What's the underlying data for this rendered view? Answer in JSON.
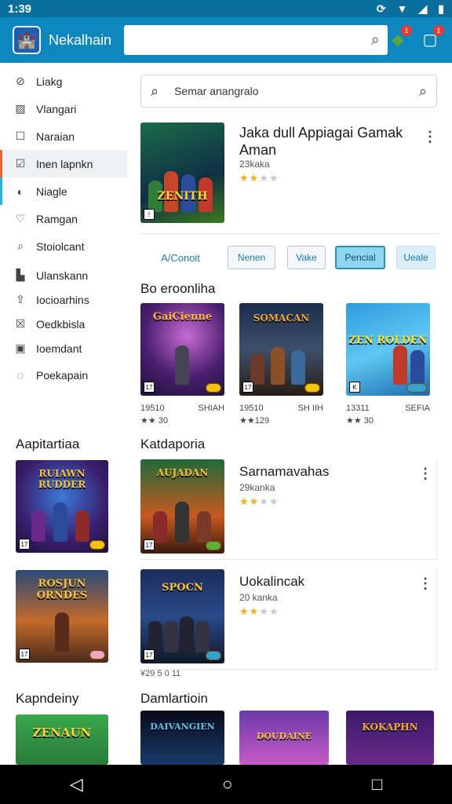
{
  "status": {
    "time": "1:39"
  },
  "appbar": {
    "app_name": "Nekalhain",
    "notif_count": "1",
    "msg_count": "1"
  },
  "sidebar": {
    "items": [
      {
        "label": "Liakg",
        "icon": "tag-icon"
      },
      {
        "label": "Vlangari",
        "icon": "image-icon"
      },
      {
        "label": "Naraian",
        "icon": "square-icon"
      },
      {
        "label": "Inen lapnkn",
        "icon": "checkbox-icon"
      },
      {
        "label": "Niagle",
        "icon": "droplet-icon"
      },
      {
        "label": "Ramgan",
        "icon": "heart-icon"
      },
      {
        "label": "Stoiolcant",
        "icon": "search-icon"
      },
      {
        "label": "Ulanskann",
        "icon": "bars-icon"
      },
      {
        "label": "Iocioarhins",
        "icon": "upload-icon"
      },
      {
        "label": "Oedkbisla",
        "icon": "close-box-icon"
      },
      {
        "label": "Ioemdant",
        "icon": "lock-icon"
      },
      {
        "label": "Poekapain",
        "icon": "chat-icon"
      }
    ]
  },
  "search": {
    "placeholder": "Semar anangralo"
  },
  "featured": {
    "title": "Jaka dull Appiagai Gamak Aman",
    "subtitle": "23kaka",
    "stars": 2,
    "cover": {
      "text": "ZENITH"
    }
  },
  "chips": [
    "A/Conoit",
    "Nenen",
    "Vake",
    "Pencial",
    "Ueale"
  ],
  "sections": {
    "recommend": "Bo eroonliha",
    "left_featured": "Aapitartiaa",
    "category": "Katdaporia",
    "left_bottom": "Kapndeiny",
    "bottom_main": "Damlartioin"
  },
  "grid": [
    {
      "cover": "GaiCienne",
      "num": "19510",
      "tag": "SHIAH",
      "rating": "★★ 30"
    },
    {
      "cover": "SOMACAN",
      "num": "19510",
      "tag": "SH IIH",
      "rating": "★★129"
    },
    {
      "cover": "ZEN ROLDEN",
      "num": "13311",
      "tag": "SEFIA",
      "rating": "★★ 30"
    }
  ],
  "left_cards": [
    {
      "cover": "RUIAWN RUDDER"
    },
    {
      "cover": "ROSJUN ORNDES"
    }
  ],
  "list_cards": [
    {
      "title": "Sarnamavahas",
      "sub": "29kanka",
      "stars": 2,
      "cover": "AUJADAN"
    },
    {
      "title": "Uokalincak",
      "sub": "20 kanka",
      "stars": 2,
      "cover": "SPOCN"
    }
  ],
  "list_footer": "¥29 5 0 11",
  "bottom_row": [
    {
      "cover": "ZENAUN"
    },
    {
      "cover": "DAIVANGIEN"
    },
    {
      "cover": "DOUDAINE"
    },
    {
      "cover": "KOKAPHN"
    }
  ],
  "colors": {
    "appbar": "#0e87bf",
    "status": "#0a6f9c",
    "accent": "#2ab3e0",
    "star": "#f2b01e"
  }
}
